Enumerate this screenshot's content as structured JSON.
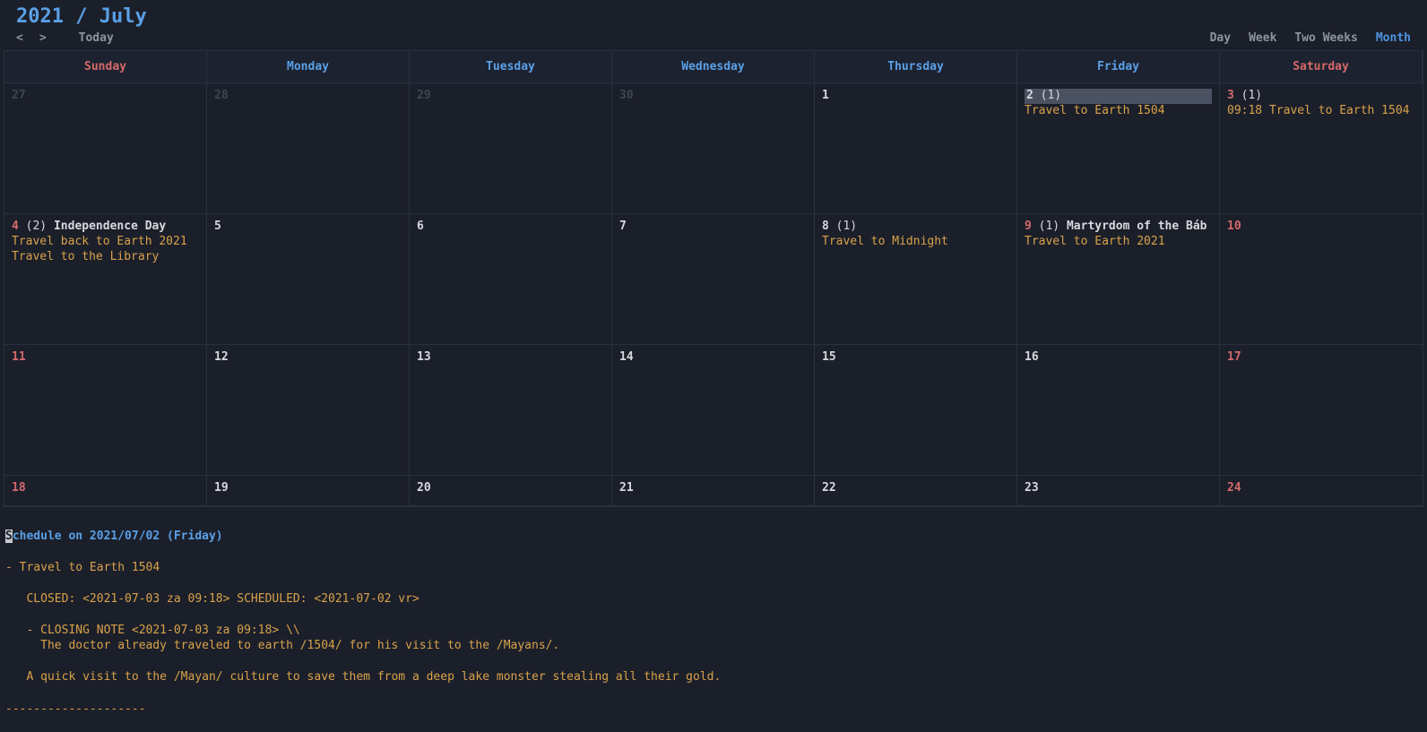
{
  "header": {
    "title": "2021 / July",
    "prev": "<",
    "next": ">",
    "today": "Today",
    "views": {
      "day": "Day",
      "week": "Week",
      "two_weeks": "Two Weeks",
      "month": "Month"
    },
    "active_view": "month"
  },
  "weekdays": [
    "Sunday",
    "Monday",
    "Tuesday",
    "Wednesday",
    "Thursday",
    "Friday",
    "Saturday"
  ],
  "weeks": [
    [
      {
        "num": "27",
        "style": "dim"
      },
      {
        "num": "28",
        "style": "dim"
      },
      {
        "num": "29",
        "style": "dim"
      },
      {
        "num": "30",
        "style": "dim"
      },
      {
        "num": "1",
        "style": "white"
      },
      {
        "num": "2",
        "style": "white",
        "count": "(1)",
        "highlight": true,
        "events": [
          "Travel to Earth 1504"
        ]
      },
      {
        "num": "3",
        "style": "red",
        "count": "(1)",
        "events": [
          "09:18 Travel to Earth 1504"
        ]
      }
    ],
    [
      {
        "num": "4",
        "style": "red",
        "count": "(2)",
        "holiday": "Independence Day",
        "events": [
          "Travel back to Earth 2021",
          "Travel to the Library"
        ]
      },
      {
        "num": "5",
        "style": "white"
      },
      {
        "num": "6",
        "style": "white"
      },
      {
        "num": "7",
        "style": "white"
      },
      {
        "num": "8",
        "style": "white",
        "count": "(1)",
        "events": [
          "Travel to Midnight"
        ]
      },
      {
        "num": "9",
        "style": "red",
        "count": "(1)",
        "holiday": "Martyrdom of the Báb",
        "events": [
          "Travel to Earth 2021"
        ]
      },
      {
        "num": "10",
        "style": "red"
      }
    ],
    [
      {
        "num": "11",
        "style": "red"
      },
      {
        "num": "12",
        "style": "white"
      },
      {
        "num": "13",
        "style": "white"
      },
      {
        "num": "14",
        "style": "white"
      },
      {
        "num": "15",
        "style": "white"
      },
      {
        "num": "16",
        "style": "white"
      },
      {
        "num": "17",
        "style": "red"
      }
    ],
    [
      {
        "num": "18",
        "style": "red"
      },
      {
        "num": "19",
        "style": "white"
      },
      {
        "num": "20",
        "style": "white"
      },
      {
        "num": "21",
        "style": "white"
      },
      {
        "num": "22",
        "style": "white"
      },
      {
        "num": "23",
        "style": "white"
      },
      {
        "num": "24",
        "style": "red"
      }
    ]
  ],
  "detail": {
    "title_label": "chedule on 2021/07/02 (Friday)",
    "title_cursor": "S",
    "item_title": "- Travel to Earth 1504",
    "closed_line": "   CLOSED: <2021-07-03 za 09:18> SCHEDULED: <2021-07-02 vr>",
    "note_line1": "   - CLOSING NOTE <2021-07-03 za 09:18> \\\\",
    "note_line2": "     The doctor already traveled to earth /1504/ for his visit to the /Mayans/.",
    "desc_line": "   A quick visit to the /Mayan/ culture to save them from a deep lake monster stealing all their gold.",
    "dashes": "--------------------"
  }
}
